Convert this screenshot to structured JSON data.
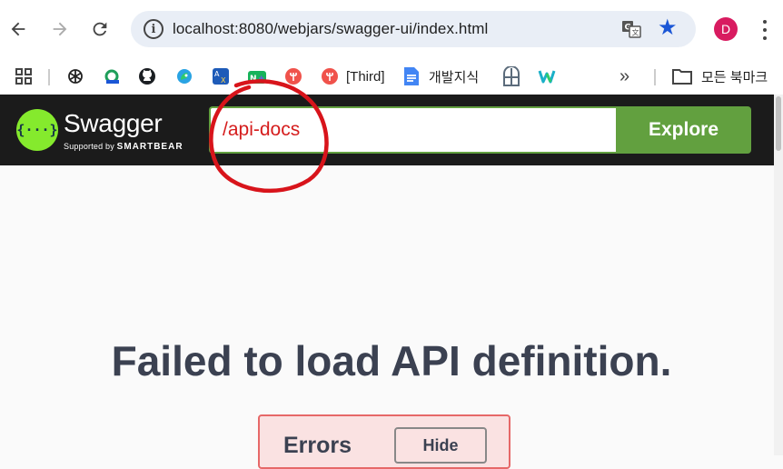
{
  "browser": {
    "url": "localhost:8080/webjars/swagger-ui/index.html",
    "avatar_letter": "D",
    "accent": "#1a56d6",
    "avatar_color": "#d81b60"
  },
  "bookmarks": {
    "items": [
      {
        "label": "",
        "icon": "apps-grid-icon"
      },
      {
        "label": "",
        "icon": "openai-icon"
      },
      {
        "label": "",
        "icon": "green-e-icon"
      },
      {
        "label": "",
        "icon": "github-icon"
      },
      {
        "label": "",
        "icon": "parrot-icon"
      },
      {
        "label": "",
        "icon": "translate-ax-icon"
      },
      {
        "label": "",
        "icon": "naver-plus-icon"
      },
      {
        "label": "",
        "icon": "red-fork-icon"
      },
      {
        "label": "[Third]",
        "icon": "red-fork-icon"
      },
      {
        "label": "개발지식",
        "icon": "google-docs-icon"
      },
      {
        "label": "",
        "icon": "window-icon"
      },
      {
        "label": "",
        "icon": "w-icon"
      }
    ],
    "overflow": "»",
    "all_bookmarks": "모든 북마크"
  },
  "swagger": {
    "brand": "Swagger",
    "supported_by": "Supported by",
    "smartbear": "SMARTBEAR",
    "definition_url": "/api-docs",
    "explore_label": "Explore",
    "brand_color": "#85ea2d",
    "button_color": "#62a03f"
  },
  "main": {
    "fail_title": "Failed to load API definition.",
    "errors_title": "Errors",
    "hide_label": "Hide"
  }
}
